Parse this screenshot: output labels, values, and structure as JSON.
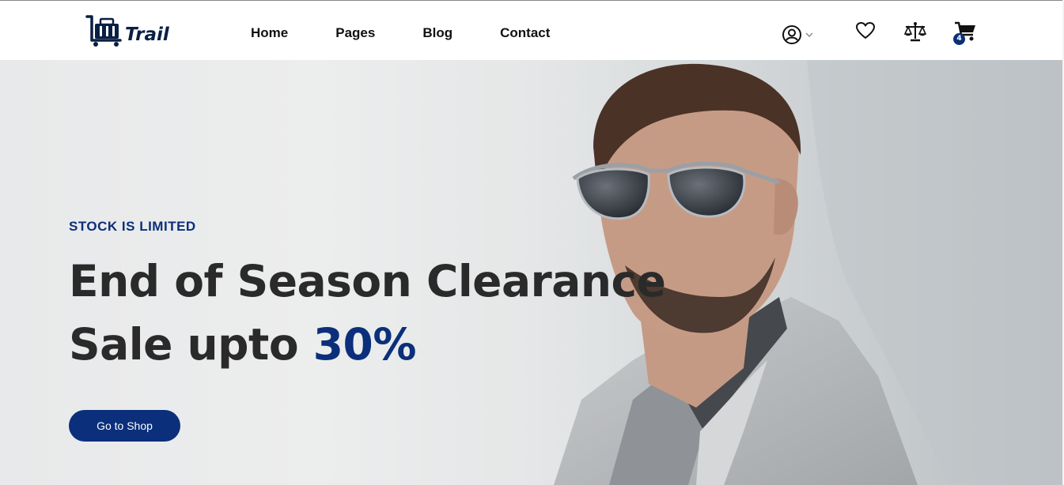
{
  "brand": {
    "name": "Trail",
    "color": "#0a1f44"
  },
  "nav": {
    "items": [
      "Home",
      "Pages",
      "Blog",
      "Contact"
    ]
  },
  "header_icons": {
    "user": "user-circle-icon",
    "wishlist": "heart-icon",
    "compare": "scale-icon",
    "cart": "cart-icon",
    "cart_count": "4"
  },
  "hero": {
    "eyebrow": "STOCK IS LIMITED",
    "headline_line1": "End of Season Clearance",
    "headline_line2_prefix": "Sale upto ",
    "headline_line2_accent": "30%",
    "cta_label": "Go to Shop"
  },
  "colors": {
    "accent": "#0b2f7a",
    "text": "#2a2a2a"
  }
}
